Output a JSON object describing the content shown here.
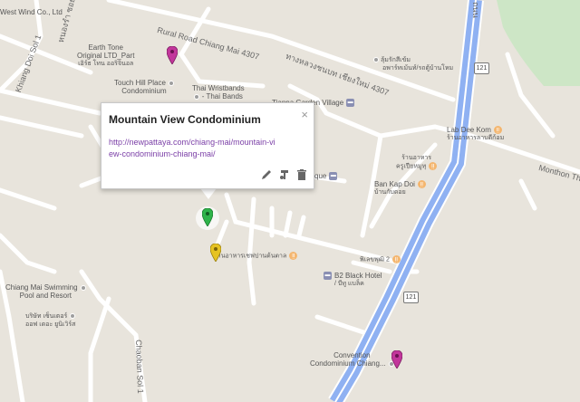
{
  "map": {
    "place_labels": [
      {
        "id": "west-wind",
        "text": "West Wind Co., Ltd"
      },
      {
        "id": "earth-tone",
        "line1": "Earth Tone",
        "line2": "Original LTD_Part",
        "line3": "เอิร์ธ โทน ออริจินอล"
      },
      {
        "id": "touch-hill",
        "line1": "Touch Hill Place",
        "line2": "Condominium"
      },
      {
        "id": "thai-wristbands",
        "line1": "Thai Wristbands",
        "line2": "- Thai Bands"
      },
      {
        "id": "tianna",
        "text": "Tianna Garden Village"
      },
      {
        "id": "thai-label-top",
        "line1": "ลุ้มรักสีเข้ม",
        "line2": "อพาร์ทเม้นท์/รถตู้บ้านโหม"
      },
      {
        "id": "lab-dee-kom",
        "text": "Lab Dee Kom"
      },
      {
        "id": "lab-dee-kom-thai",
        "text": "ร้านอาหารลาบดีก้อม"
      },
      {
        "id": "restaurant-thai",
        "line1": "ร้านอาหาร",
        "line2": "ครูเปียหมูทุ"
      },
      {
        "id": "ban-kap-doi",
        "text": "Ban Kap Doi"
      },
      {
        "id": "ban-kap-doi-thai",
        "text": "บ้านกับดอย"
      },
      {
        "id": "que",
        "text": "que"
      },
      {
        "id": "restaurant-2",
        "text": "ร้านอาหารเชฟปานต้นตาล"
      },
      {
        "id": "restaurant-3",
        "text": "พิเลขพุฒิ 2"
      },
      {
        "id": "b2-hotel",
        "line1": "B2 Black Hotel",
        "line2": "/ บีทู แบล็ค"
      },
      {
        "id": "swimming",
        "line1": "Chiang Mai Swimming",
        "line2": "Pool and Resort"
      },
      {
        "id": "company-thai",
        "line1": "บริษัท เซ็นเตอร์",
        "line2": "ออฟ เดอะ ยูนิเวิร์ส"
      },
      {
        "id": "convention",
        "line1": "Convention",
        "line2": "Condominium Chiang..."
      }
    ],
    "road_labels": {
      "rural_road": "Rural Road Chiang Mai 4307",
      "thai_road": "ทางหลวงชนบท เชียงใหม่ 4307",
      "khiang_doi": "Khiang Doi Sol 1",
      "thai_side": "หนองรำ ซอย 1",
      "chaoban": "Chaoban Sol 1",
      "monthon": "Monthon Th",
      "highway_thai": "ถนน"
    },
    "shields": {
      "top": "121",
      "bottom": "121"
    },
    "markers": [
      {
        "name": "pink-marker-top",
        "color": "#c2369b"
      },
      {
        "name": "green-marker-selected",
        "color": "#2fb34a"
      },
      {
        "name": "yellow-marker",
        "color": "#e6c323"
      },
      {
        "name": "pink-marker-bottom",
        "color": "#c2369b"
      }
    ],
    "colors": {
      "land": "#e8e4dc",
      "road": "#ffffff",
      "highway": "#8fb1f2",
      "park": "#cde6c6"
    }
  },
  "info_window": {
    "title": "Mountain View Condominium",
    "url": "http://newpattaya.com/chiang-mai/mountain-view-condominium-chiang-mai/",
    "close_symbol": "×",
    "tools": [
      "edit-icon",
      "style-icon",
      "delete-icon"
    ]
  }
}
